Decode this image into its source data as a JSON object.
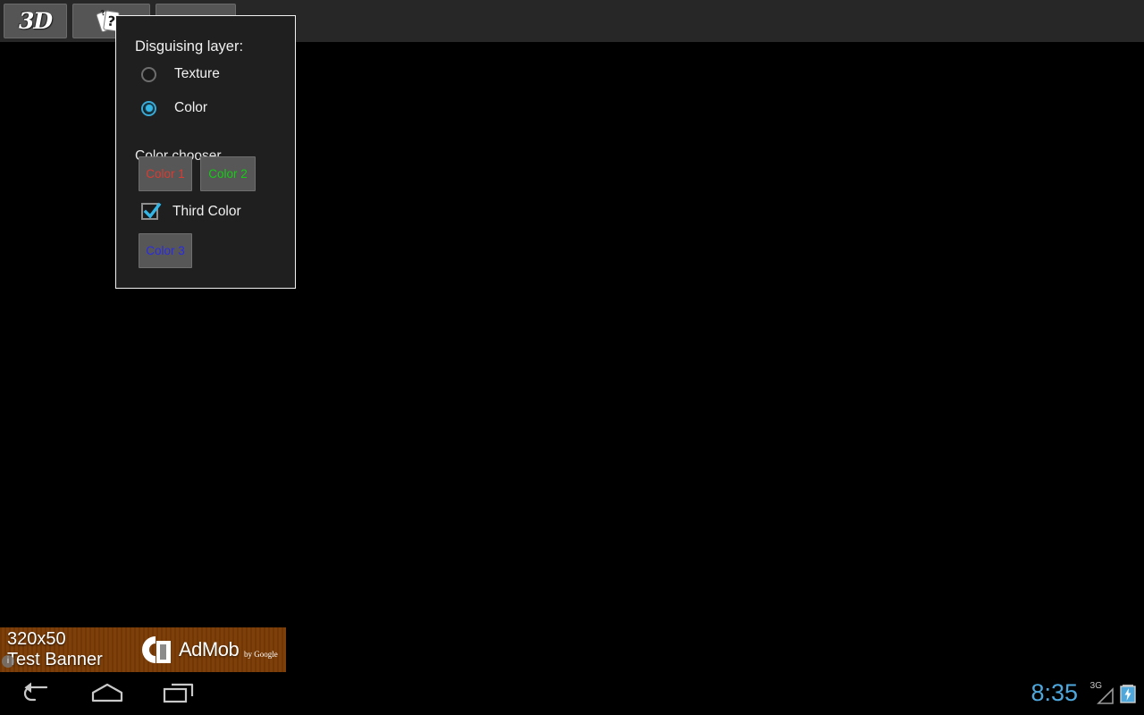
{
  "toolbar": {
    "button_3d_label": "3D",
    "button_cards_icon": "cards-question-icon",
    "button_empty_label": ""
  },
  "dialog": {
    "title": "Disguising layer:",
    "radio_group": {
      "name": "disguising-layer",
      "options": [
        {
          "label": "Texture",
          "selected": false
        },
        {
          "label": "Color",
          "selected": true
        }
      ]
    },
    "chooser_label": "Color chooser...",
    "color_buttons": [
      {
        "label": "Color 1",
        "text_color": "#d83c32"
      },
      {
        "label": "Color 2",
        "text_color": "#16cc16"
      },
      {
        "label": "Color 3",
        "text_color": "#2a2ae0"
      }
    ],
    "checkbox": {
      "label": "Third Color",
      "checked": true
    },
    "accent_color": "#33b5e5",
    "background_color": "#1f1f1f",
    "border_color": "#f2f2f2"
  },
  "ad_banner": {
    "line1": "320x50",
    "line2": "Test Banner",
    "info_icon": "info-icon",
    "brand": "AdMob",
    "brand_suffix": "by Google",
    "logo_icon": "admob-logo-icon"
  },
  "navbar": {
    "back_icon": "back-arrow-icon",
    "home_icon": "home-icon",
    "recents_icon": "recent-apps-icon"
  },
  "statusbar": {
    "time": "8:35",
    "network": "3G",
    "signal_icon": "signal-triangle-icon",
    "battery_icon": "battery-charging-icon",
    "time_color": "#4ea8dd"
  }
}
